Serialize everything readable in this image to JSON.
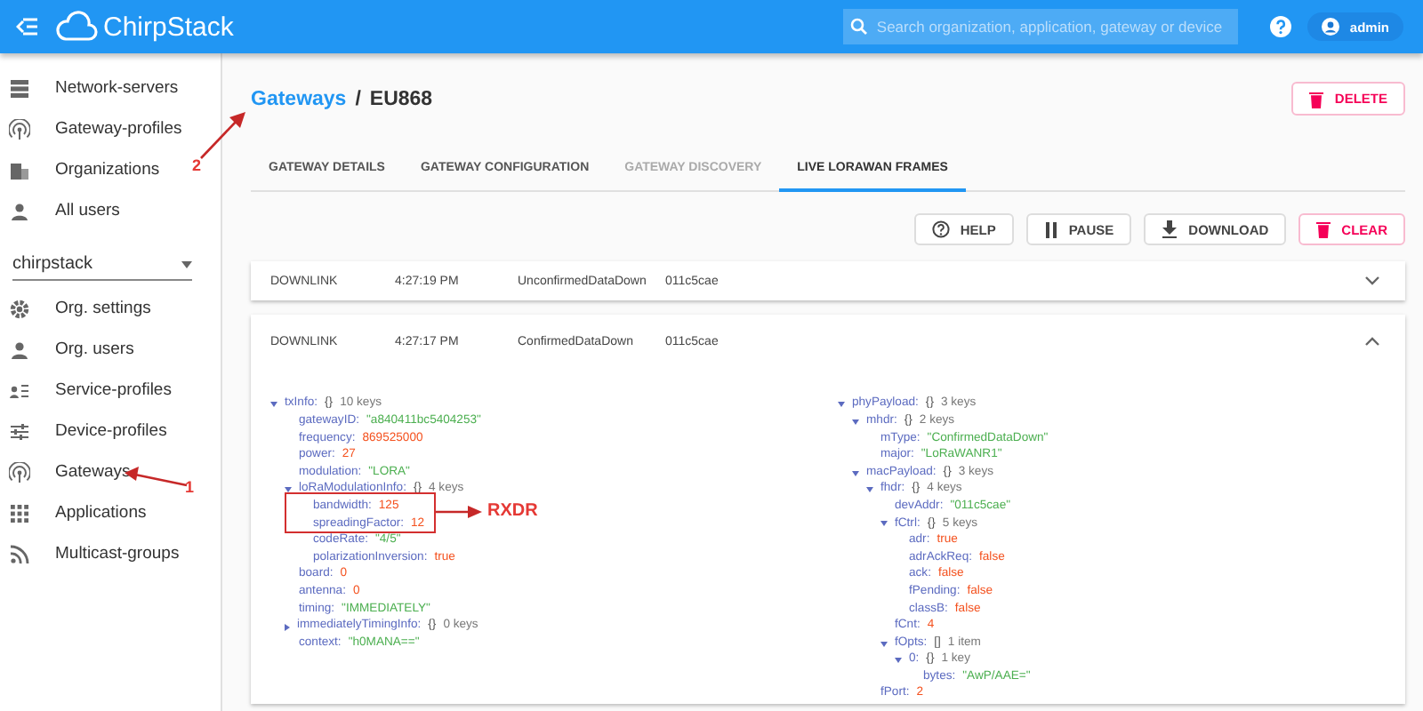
{
  "header": {
    "logo": "ChirpStack",
    "search": {
      "placeholder": "Search organization, application, gateway or device"
    },
    "user": "admin"
  },
  "sidebar": {
    "items": [
      {
        "label": "Network-servers",
        "selected": false
      },
      {
        "label": "Gateway-profiles",
        "selected": false
      },
      {
        "label": "Organizations",
        "selected": false
      },
      {
        "label": "All users",
        "selected": false
      }
    ],
    "org_select": {
      "value": "chirpstack"
    },
    "org_items": [
      {
        "label": "Org. settings",
        "selected": false
      },
      {
        "label": "Org. users",
        "selected": false
      },
      {
        "label": "Service-profiles",
        "selected": false
      },
      {
        "label": "Device-profiles",
        "selected": false
      },
      {
        "label": "Gateways",
        "selected": false
      },
      {
        "label": "Applications",
        "selected": false
      },
      {
        "label": "Multicast-groups",
        "selected": false
      }
    ]
  },
  "breadcrumb": {
    "link": "Gateways",
    "separator": "/",
    "current": "EU868"
  },
  "delete_button": "DELETE",
  "tabs": [
    {
      "label": "GATEWAY DETAILS",
      "selected": false,
      "disabled": false
    },
    {
      "label": "GATEWAY CONFIGURATION",
      "selected": false,
      "disabled": false
    },
    {
      "label": "GATEWAY DISCOVERY",
      "selected": false,
      "disabled": true
    },
    {
      "label": "LIVE LORAWAN FRAMES",
      "selected": true,
      "disabled": false
    }
  ],
  "actions": [
    {
      "label": "HELP",
      "kind": "help"
    },
    {
      "label": "PAUSE",
      "kind": "pause"
    },
    {
      "label": "DOWNLOAD",
      "kind": "download"
    },
    {
      "label": "CLEAR",
      "kind": "delete"
    }
  ],
  "frames": [
    {
      "direction": "DOWNLINK",
      "time": "4:27:19 PM",
      "mtype": "UnconfirmedDataDown",
      "dev_addr": "011c5cae",
      "expanded": false
    },
    {
      "direction": "DOWNLINK",
      "time": "4:27:17 PM",
      "mtype": "ConfirmedDataDown",
      "dev_addr": "011c5cae",
      "expanded": true,
      "tree_left": [
        {
          "key": "txInfo:",
          "brackets": "{}",
          "count": "10 keys",
          "expanded": true,
          "children": [
            {
              "key": "gatewayID:",
              "value": "\"a840411bc5404253\"",
              "color": "#4caf50"
            },
            {
              "key": "frequency:",
              "value": "869525000",
              "color": "#f4511e"
            },
            {
              "key": "power:",
              "value": "27",
              "color": "#f4511e"
            },
            {
              "key": "modulation:",
              "value": "\"LORA\"",
              "color": "#4caf50"
            },
            {
              "key": "loRaModulationInfo:",
              "brackets": "{}",
              "count": "4 keys",
              "expanded": true,
              "children": [
                {
                  "key": "bandwidth:",
                  "value": "125",
                  "color": "#f4511e"
                },
                {
                  "key": "spreadingFactor:",
                  "value": "12",
                  "color": "#f4511e"
                },
                {
                  "key": "codeRate:",
                  "value": "\"4/5\"",
                  "color": "#4caf50"
                },
                {
                  "key": "polarizationInversion:",
                  "value": "true",
                  "color": "#f4511e"
                }
              ]
            },
            {
              "key": "board:",
              "value": "0",
              "color": "#f4511e"
            },
            {
              "key": "antenna:",
              "value": "0",
              "color": "#f4511e"
            },
            {
              "key": "timing:",
              "value": "\"IMMEDIATELY\"",
              "color": "#4caf50"
            },
            {
              "key": "immediatelyTimingInfo:",
              "brackets": "{}",
              "count": "0 keys",
              "expanded": false
            },
            {
              "key": "context:",
              "value": "\"h0MANA==\"",
              "color": "#4caf50"
            }
          ]
        }
      ],
      "tree_right": [
        {
          "key": "phyPayload:",
          "brackets": "{}",
          "count": "3 keys",
          "expanded": true,
          "children": [
            {
              "key": "mhdr:",
              "brackets": "{}",
              "count": "2 keys",
              "expanded": true,
              "children": [
                {
                  "key": "mType:",
                  "value": "\"ConfirmedDataDown\"",
                  "color": "#4caf50"
                },
                {
                  "key": "major:",
                  "value": "\"LoRaWANR1\"",
                  "color": "#4caf50"
                }
              ]
            },
            {
              "key": "macPayload:",
              "brackets": "{}",
              "count": "3 keys",
              "expanded": true,
              "children": [
                {
                  "key": "fhdr:",
                  "brackets": "{}",
                  "count": "4 keys",
                  "expanded": true,
                  "children": [
                    {
                      "key": "devAddr:",
                      "value": "\"011c5cae\"",
                      "color": "#4caf50"
                    },
                    {
                      "key": "fCtrl:",
                      "brackets": "{}",
                      "count": "5 keys",
                      "expanded": true,
                      "children": [
                        {
                          "key": "adr:",
                          "value": "true",
                          "color": "#f4511e"
                        },
                        {
                          "key": "adrAckReq:",
                          "value": "false",
                          "color": "#f4511e"
                        },
                        {
                          "key": "ack:",
                          "value": "false",
                          "color": "#f4511e"
                        },
                        {
                          "key": "fPending:",
                          "value": "false",
                          "color": "#f4511e"
                        },
                        {
                          "key": "classB:",
                          "value": "false",
                          "color": "#f4511e"
                        }
                      ]
                    },
                    {
                      "key": "fCnt:",
                      "value": "4",
                      "color": "#f4511e"
                    },
                    {
                      "key": "fOpts:",
                      "brackets": "[]",
                      "count": "1 item",
                      "expanded": true,
                      "children": [
                        {
                          "key": "0:",
                          "brackets": "{}",
                          "count": "1 key",
                          "expanded": true,
                          "children": [
                            {
                              "key": "bytes:",
                              "value": "\"AwP/AAE=\"",
                              "color": "#4caf50"
                            }
                          ]
                        }
                      ]
                    }
                  ]
                },
                {
                  "key": "fPort:",
                  "value": "2",
                  "color": "#f4511e"
                }
              ]
            }
          ]
        }
      ]
    }
  ],
  "annotations": [
    {
      "kind": "arrow",
      "label": "2"
    },
    {
      "kind": "arrow",
      "label": "1"
    },
    {
      "kind": "box"
    },
    {
      "kind": "arrow",
      "label": "RXDR"
    }
  ]
}
